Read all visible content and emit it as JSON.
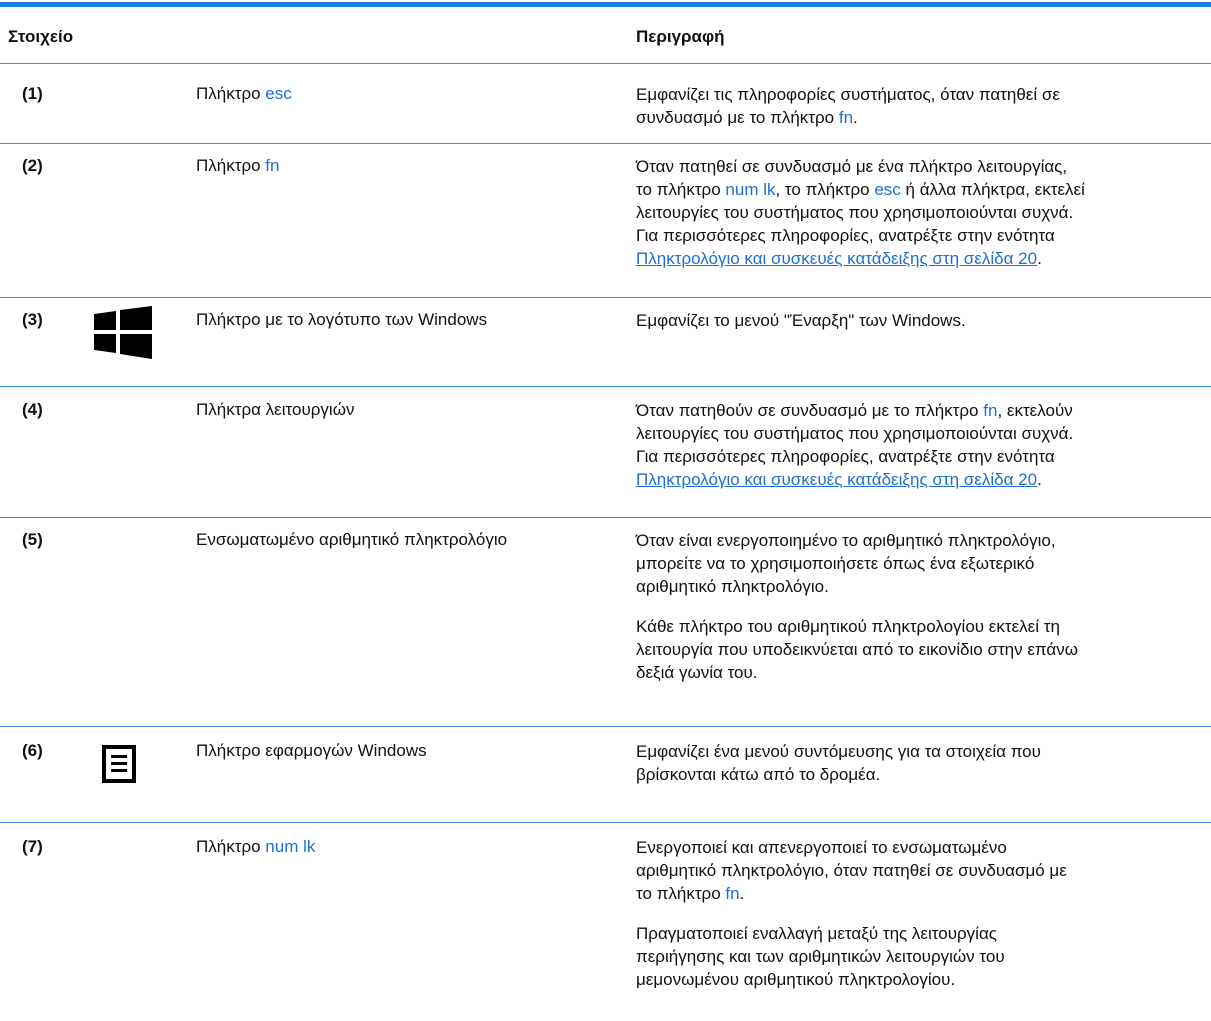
{
  "header": {
    "col_item": "Στοιχείο",
    "col_description": "Περιγραφή"
  },
  "rows": [
    {
      "num": "(1)",
      "name_prefix": "Πλήκτρο ",
      "name_key": "esc",
      "desc": {
        "p1_a": "Εμφανίζει τις πληροφορίες συστήματος, όταν πατηθεί σε",
        "p1_b": "συνδυασμό με το πλήκτρο ",
        "p1_key": "fn",
        "p1_end": "."
      }
    },
    {
      "num": "(2)",
      "name_prefix": "Πλήκτρο ",
      "name_key": "fn",
      "desc": {
        "l1": "Όταν πατηθεί σε συνδυασμό με ένα πλήκτρο λειτουργίας,",
        "l2_a": "το πλήκτρο ",
        "l2_k1": "num lk",
        "l2_b": ", το πλήκτρο ",
        "l2_k2": "esc",
        "l2_c": " ή άλλα πλήκτρα, εκτελεί",
        "l3": "λειτουργίες του συστήματος που χρησιμοποιούνται συχνά.",
        "l4": "Για περισσότερες πληροφορίες, ανατρέξτε στην ενότητα",
        "xref": "Πληκτρολόγιο και συσκευές κατάδειξης στη σελίδα 20",
        "end": "."
      }
    },
    {
      "num": "(3)",
      "icon": "windows-logo-icon",
      "name": "Πλήκτρο με το λογότυπο των Windows",
      "desc": "Εμφανίζει το μενού \"Έναρξη\" των Windows."
    },
    {
      "num": "(4)",
      "name": "Πλήκτρα λειτουργιών",
      "desc": {
        "l1_a": "Όταν πατηθούν σε συνδυασμό με το πλήκτρο ",
        "l1_key": "fn",
        "l1_b": ", εκτελούν",
        "l2": "λειτουργίες του συστήματος που χρησιμοποιούνται συχνά.",
        "l3": "Για περισσότερες πληροφορίες, ανατρέξτε στην ενότητα",
        "xref": "Πληκτρολόγιο και συσκευές κατάδειξης στη σελίδα 20",
        "end": "."
      }
    },
    {
      "num": "(5)",
      "name": "Ενσωματωμένο αριθμητικό πληκτρολόγιο",
      "desc": {
        "p1_l1": "Όταν είναι ενεργοποιημένο το αριθμητικό πληκτρολόγιο,",
        "p1_l2": "μπορείτε να το χρησιμοποιήσετε όπως ένα εξωτερικό",
        "p1_l3": "αριθμητικό πληκτρολόγιο.",
        "p2_l1": "Κάθε πλήκτρο του αριθμητικού πληκτρολογίου εκτελεί τη",
        "p2_l2": "λειτουργία που υποδεικνύεται από το εικονίδιο στην επάνω",
        "p2_l3": "δεξιά γωνία του."
      }
    },
    {
      "num": "(6)",
      "icon": "applications-key-icon",
      "name": "Πλήκτρο εφαρμογών Windows",
      "desc": {
        "l1": "Εμφανίζει ένα μενού συντόμευσης για τα στοιχεία που",
        "l2": "βρίσκονται κάτω από το δρομέα."
      }
    },
    {
      "num": "(7)",
      "name_prefix": "Πλήκτρο ",
      "name_key": "num lk",
      "desc": {
        "p1_l1": "Ενεργοποιεί και απενεργοποιεί το ενσωματωμένο",
        "p1_l2": "αριθμητικό πληκτρολόγιο, όταν πατηθεί σε συνδυασμό με",
        "p1_l3_a": "το πλήκτρο ",
        "p1_l3_key": "fn",
        "p1_l3_end": ".",
        "p2_l1": "Πραγματοποιεί εναλλαγή μεταξύ της λειτουργίας",
        "p2_l2": "περιήγησης και των αριθμητικών λειτουργιών του",
        "p2_l3": "μεμονωμένου αριθμητικού πληκτρολογίου."
      }
    }
  ],
  "colors": {
    "rule": "#1a7fd6",
    "row_line": "#3b8ddd",
    "key_text": "#1f6fd0"
  }
}
